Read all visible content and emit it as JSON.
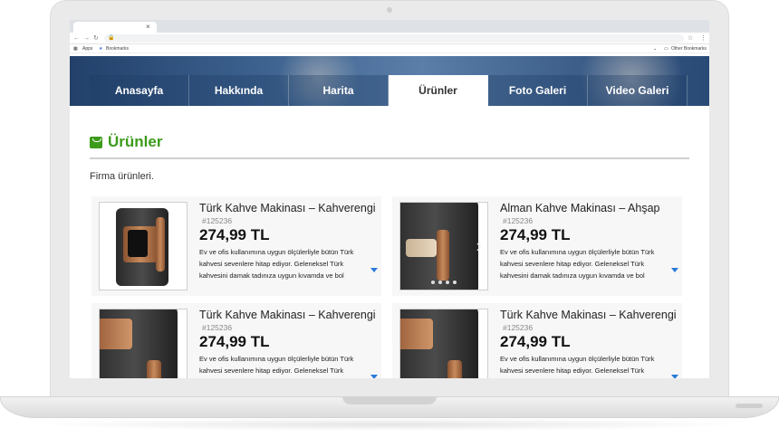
{
  "browser": {
    "tab_close": "×",
    "bookmarks": {
      "apps": "Apps",
      "bookmarks": "Bookmarks",
      "other": "Other Bookmarks"
    }
  },
  "nav": {
    "items": [
      {
        "label": "Anasayfa",
        "active": false
      },
      {
        "label": "Hakkında",
        "active": false
      },
      {
        "label": "Harita",
        "active": false
      },
      {
        "label": "Ürünler",
        "active": true
      },
      {
        "label": "Foto Galeri",
        "active": false
      },
      {
        "label": "Video Galeri",
        "active": false
      }
    ]
  },
  "page": {
    "title": "Ürünler",
    "intro": "Firma ürünleri."
  },
  "products": [
    {
      "name": "Türk Kahve Makinası – Kahverengi",
      "code": "#125236",
      "price": "274,99 TL",
      "desc": "Ev ve ofis kullanımına uygun ölçülerliyle bütün Türk kahvesi sevenlere hitap ediyor. Geleneksel Türk kahvesini damak tadınıza uygun kıvamda ve bol"
    },
    {
      "name": "Alman Kahve Makinası – Ahşap",
      "code": "#125236",
      "price": "274,99 TL",
      "desc": "Ev ve ofis kullanımına uygun ölçülerliyle bütün Türk kahvesi sevenlere hitap ediyor. Geleneksel Türk kahvesini damak tadınıza uygun kıvamda ve bol"
    },
    {
      "name": "Türk Kahve Makinası – Kahverengi",
      "code": "#125236",
      "price": "274,99 TL",
      "desc": "Ev ve ofis kullanımına uygun ölçülerliyle bütün Türk kahvesi sevenlere hitap ediyor. Geleneksel Türk kahvesini damak tadınıza uygun kıvamda ve bol"
    },
    {
      "name": "Türk Kahve Makinası – Kahverengi",
      "code": "#125236",
      "price": "274,99 TL",
      "desc": "Ev ve ofis kullanımına uygun ölçülerliyle bütün Türk kahvesi sevenlere hitap ediyor. Geleneksel Türk kahvesini damak tadınıza uygun kıvamda ve bol"
    }
  ]
}
